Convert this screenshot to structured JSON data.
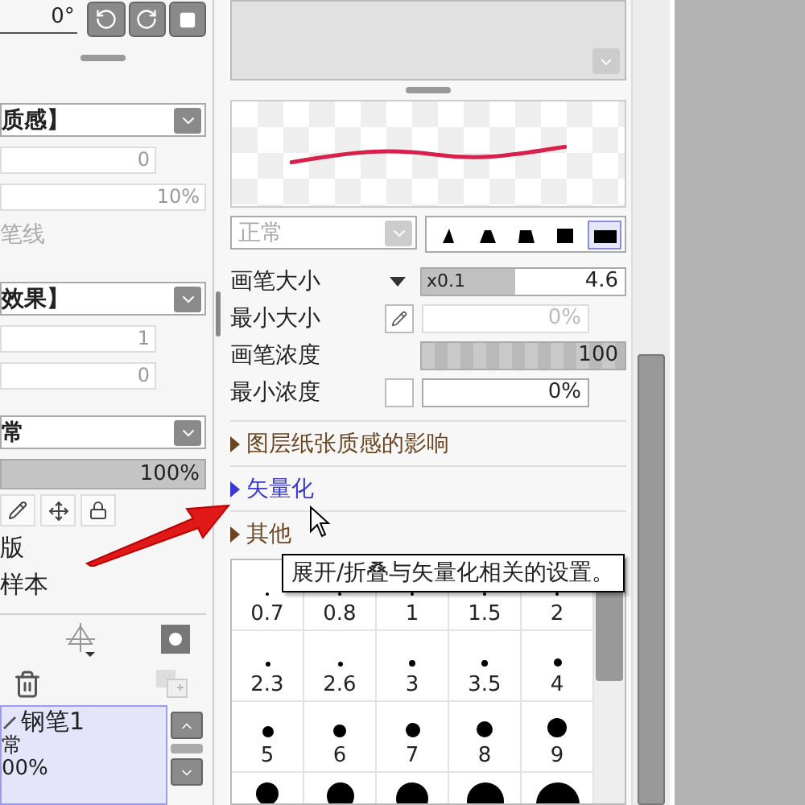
{
  "left_panel": {
    "angle": "0°",
    "rows": [
      {
        "kind": "dropdown",
        "value": "质感】",
        "disabled": false
      },
      {
        "kind": "field",
        "value": "0",
        "disabled": true
      },
      {
        "kind": "wide_field",
        "value": "10%",
        "disabled": true
      },
      {
        "kind": "label",
        "value": "笔线",
        "disabled": true
      },
      {
        "kind": "dropdown",
        "value": "效果】",
        "disabled": false
      },
      {
        "kind": "field",
        "value": "1",
        "disabled": true
      },
      {
        "kind": "field",
        "value": "0",
        "disabled": true
      },
      {
        "kind": "dropdown",
        "value": "常",
        "disabled": false
      },
      {
        "kind": "meter",
        "value": "100%",
        "level": 1,
        "disabled": false
      }
    ],
    "labels": [
      "版",
      "样本"
    ],
    "layer": {
      "name": "钢笔1",
      "blend": "常",
      "opacity": "00%",
      "selected": true
    }
  },
  "brush": {
    "blend_mode": {
      "value": "正常",
      "disabled": true
    },
    "tip_shapes": [
      {
        "selected": false
      },
      {
        "selected": false
      },
      {
        "selected": false
      },
      {
        "selected": false
      },
      {
        "selected": true
      }
    ],
    "params": [
      {
        "kind": "slider",
        "label": "画笔大小",
        "prefix": "x0.1",
        "reading": "4.6",
        "level": 0.46
      },
      {
        "kind": "pressure_min",
        "label": "最小大小",
        "reading": "0%",
        "disabled": true
      },
      {
        "kind": "density",
        "label": "画笔浓度",
        "reading": "100",
        "level": 1
      },
      {
        "kind": "check_min",
        "label": "最小浓度",
        "reading": "0%",
        "checked": false
      }
    ],
    "sections": [
      {
        "label": "图层纸张质感的影响",
        "hovered": false
      },
      {
        "label": "矢量化",
        "hovered": true
      },
      {
        "label": "其他",
        "hovered": false
      }
    ],
    "size_grid": [
      {
        "kind": "tiny",
        "labels": [
          "0.7",
          "0.8",
          "1",
          "1.5",
          "2"
        ]
      },
      {
        "kind": "small",
        "labels": [
          "2.3",
          "2.6",
          "3",
          "3.5",
          "4"
        ]
      },
      {
        "kind": "medium",
        "labels": [
          "5",
          "6",
          "7",
          "8",
          "9"
        ]
      },
      {
        "kind": "large"
      }
    ],
    "tooltip": "展开/折叠与矢量化相关的设置。"
  }
}
